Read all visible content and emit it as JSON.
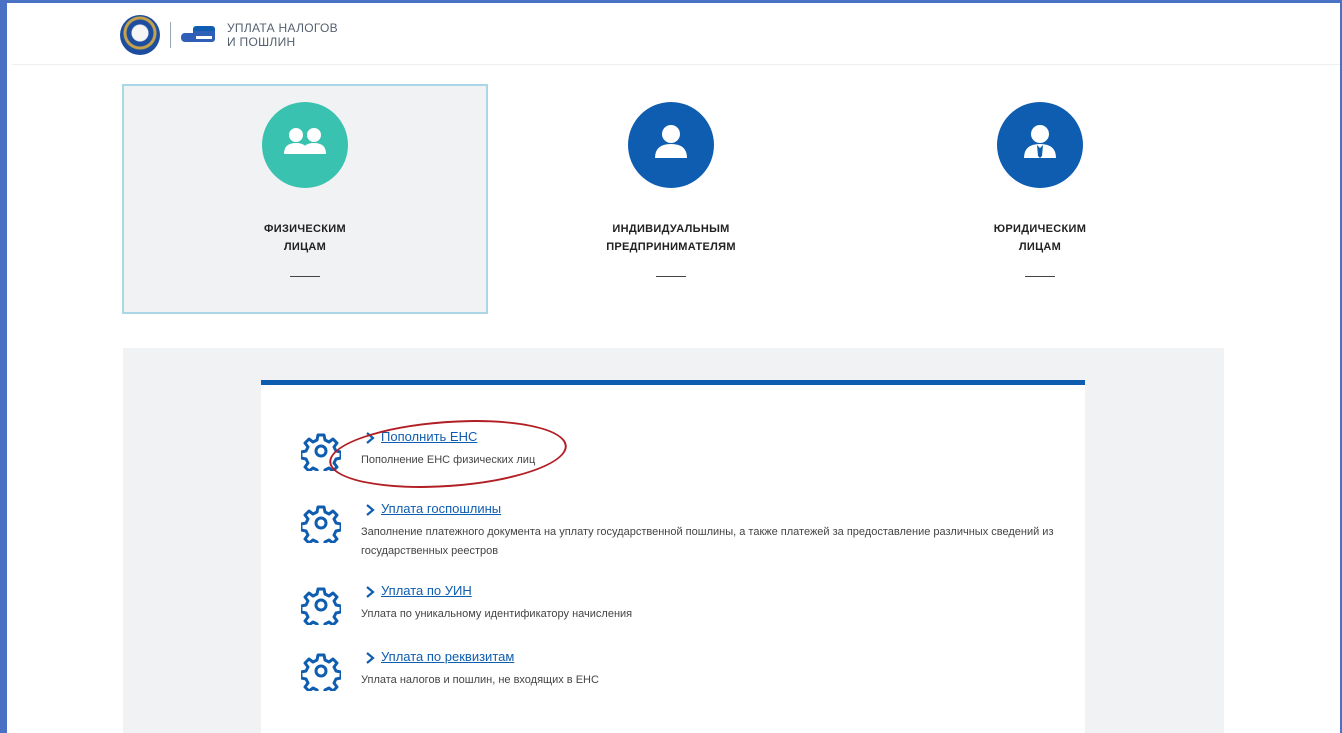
{
  "header": {
    "logo_text_line1": "УПЛАТА НАЛОГОВ",
    "logo_text_line2": "И ПОШЛИН",
    "emblem_icon": "fns-emblem-icon",
    "hand_icon": "hand-card-icon"
  },
  "categories": [
    {
      "line1": "ФИЗИЧЕСКИМ",
      "line2": "ЛИЦАМ",
      "icon": "two-persons-icon",
      "color": "#3ac2b0",
      "active": true
    },
    {
      "line1": "ИНДИВИДУАЛЬНЫМ",
      "line2": "ПРЕДПРИНИМАТЕЛЯМ",
      "icon": "person-icon",
      "color": "#0f5db0",
      "active": false
    },
    {
      "line1": "ЮРИДИЧЕСКИМ",
      "line2": "ЛИЦАМ",
      "icon": "person-tie-icon",
      "color": "#0f5db0",
      "active": false
    }
  ],
  "services": [
    {
      "title": "Пополнить ЕНС",
      "desc": "Пополнение ЕНС физических лиц",
      "icon": "gear-icon"
    },
    {
      "title": "Уплата госпошлины",
      "desc": "Заполнение платежного документа на уплату государственной пошлины, а также платежей за предоставление различных сведений из государственных реестров",
      "icon": "gear-icon"
    },
    {
      "title": "Уплата по УИН",
      "desc": "Уплата по уникальному идентификатору начисления",
      "icon": "gear-icon"
    },
    {
      "title": "Уплата по реквизитам",
      "desc": "Уплата налогов и пошлин, не входящих в ЕНС",
      "icon": "gear-icon"
    }
  ],
  "colors": {
    "accent": "#0f5db0",
    "teal": "#3ac2b0",
    "annotation": "#b31e24",
    "frame": "#4a72c4"
  }
}
